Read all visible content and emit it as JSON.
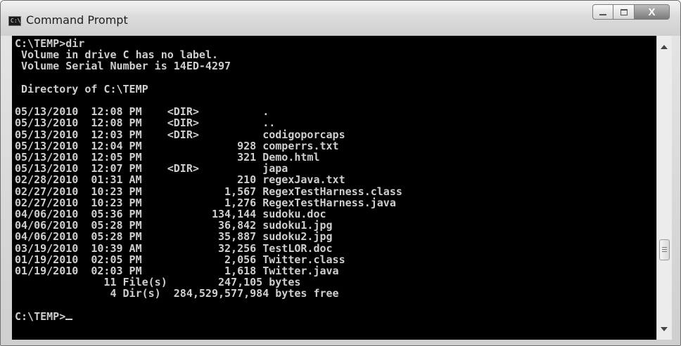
{
  "window": {
    "title": "Command Prompt",
    "icon_label": "C:\\",
    "close_label": "X"
  },
  "console": {
    "l0": "C:\\TEMP>dir",
    "l1": " Volume in drive C has no label.",
    "l2": " Volume Serial Number is 14ED-4297",
    "l3": "",
    "l4": " Directory of C:\\TEMP",
    "l5": "",
    "l6": "05/13/2010  12:08 PM    <DIR>          .",
    "l7": "05/13/2010  12:08 PM    <DIR>          ..",
    "l8": "05/13/2010  12:03 PM    <DIR>          codigoporcaps",
    "l9": "05/13/2010  12:04 PM               928 comperrs.txt",
    "l10": "05/13/2010  12:05 PM               321 Demo.html",
    "l11": "05/13/2010  12:07 PM    <DIR>          japa",
    "l12": "02/28/2010  01:31 AM               210 regexJava.txt",
    "l13": "02/27/2010  10:23 PM             1,567 RegexTestHarness.class",
    "l14": "02/27/2010  10:23 PM             1,276 RegexTestHarness.java",
    "l15": "04/06/2010  05:36 PM           134,144 sudoku.doc",
    "l16": "04/06/2010  05:28 PM            36,842 sudoku1.jpg",
    "l17": "04/06/2010  05:28 PM            35,887 sudoku2.jpg",
    "l18": "03/19/2010  10:39 AM            32,256 TestLOR.doc",
    "l19": "01/19/2010  02:05 PM             2,056 Twitter.class",
    "l20": "01/19/2010  02:03 PM             1,618 Twitter.java",
    "l21": "              11 File(s)        247,105 bytes",
    "l22": "               4 Dir(s)  284,529,577,984 bytes free",
    "l23": "",
    "prompt": "C:\\TEMP>"
  },
  "colors": {
    "console_bg": "#000000",
    "console_fg": "#cfcfcf",
    "window_chrome": "#d6d6d6"
  }
}
